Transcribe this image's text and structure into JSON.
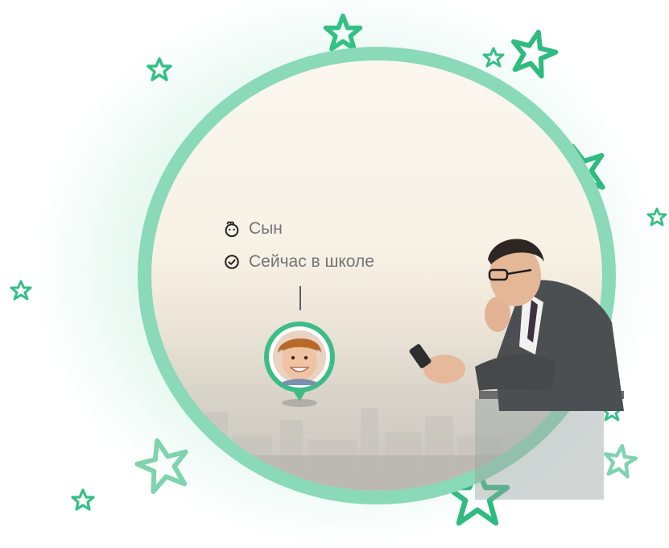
{
  "profile_card": {
    "relation_label": "Сын",
    "status_label": "Сейчас в школе"
  },
  "icons": {
    "relation": "baby-face-icon",
    "status": "check-circle-icon"
  },
  "colors": {
    "accent_green": "#3dbd86",
    "ring_green": "#8ad9b9",
    "text_gray": "#707478"
  }
}
